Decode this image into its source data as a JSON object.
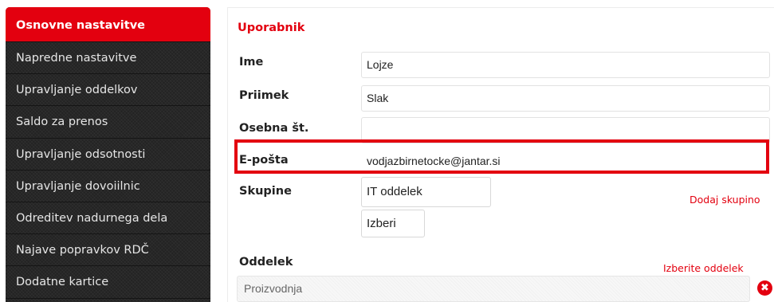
{
  "sidebar": {
    "items": [
      {
        "label": "Osnovne nastavitve",
        "active": true
      },
      {
        "label": "Napredne nastavitve"
      },
      {
        "label": "Upravljanje oddelkov"
      },
      {
        "label": "Saldo za prenos"
      },
      {
        "label": "Upravljanje odsotnosti"
      },
      {
        "label": "Upravljanje dovoiilnic"
      },
      {
        "label": "Odreditev nadurnega dela"
      },
      {
        "label": "Najave popravkov RDČ"
      },
      {
        "label": "Dodatne kartice"
      }
    ]
  },
  "user": {
    "section_title": "Uporabnik",
    "ime": {
      "label": "Ime",
      "value": "Lojze"
    },
    "priimek": {
      "label": "Priimek",
      "value": "Slak"
    },
    "osebna": {
      "label": "Osebna št.",
      "value": ""
    },
    "eposta": {
      "label": "E-pošta",
      "value": "vodjazbirnetocke@jantar.si"
    },
    "skupine": {
      "label": "Skupine",
      "group": "IT oddelek",
      "select_button": "Izberi",
      "add_link": "Dodaj skupino"
    },
    "oddelek": {
      "label": "Oddelek",
      "choose_link": "Izberite oddelek",
      "value": "Proizvodnja",
      "clear_icon": "✖"
    }
  },
  "colors": {
    "accent": "#e3000f",
    "sidebar_bg": "#232323"
  }
}
